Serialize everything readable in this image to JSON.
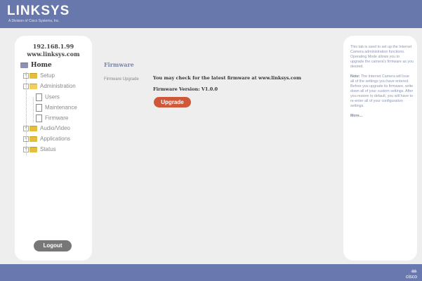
{
  "header": {
    "logo_text": "LINKSYS",
    "logo_sub": "A Division of Cisco Systems, Inc."
  },
  "footer": {
    "cisco_logo": "cisco"
  },
  "sidebar": {
    "ip": "192.168.1.99",
    "url": "www.linksys.com",
    "items": [
      {
        "label": "Home",
        "icon": "folder-icon"
      },
      {
        "label": "Setup",
        "icon": "folder-icon"
      },
      {
        "label": "Administration",
        "icon": "folder-open-icon"
      },
      {
        "label": "Users",
        "icon": "document-icon"
      },
      {
        "label": "Maintenance",
        "icon": "document-icon"
      },
      {
        "label": "Firmware",
        "icon": "document-icon"
      },
      {
        "label": "Audio/Video",
        "icon": "folder-icon"
      },
      {
        "label": "Applications",
        "icon": "folder-icon"
      },
      {
        "label": "Status",
        "icon": "folder-icon"
      }
    ],
    "logout_label": "Logout"
  },
  "main": {
    "title": "Firmware",
    "upgrade_label": "Firmware Upgrade",
    "check_text": "You may check for the latest firmware at www.linksys.com",
    "version_text": "Firmware Version: V1.0.0",
    "upgrade_button": "Upgrade"
  },
  "help": {
    "para1": "This tab is used to set up the Internet Camera administration functions. Operating Mode allows you to upgrade the camera's firmware as you desired.",
    "note_label": "Note:",
    "para2": "The Internet Camera will lose all of the settings you have entered. Before you upgrade its firmware, write down all of your custom settings. After you restore to default, you will have to re-enter all of your configuration settings.",
    "more": "More..."
  },
  "colors": {
    "brand": "#6a78b0",
    "upgrade_button": "#d0583a",
    "content_bg": "#eeeeee"
  }
}
